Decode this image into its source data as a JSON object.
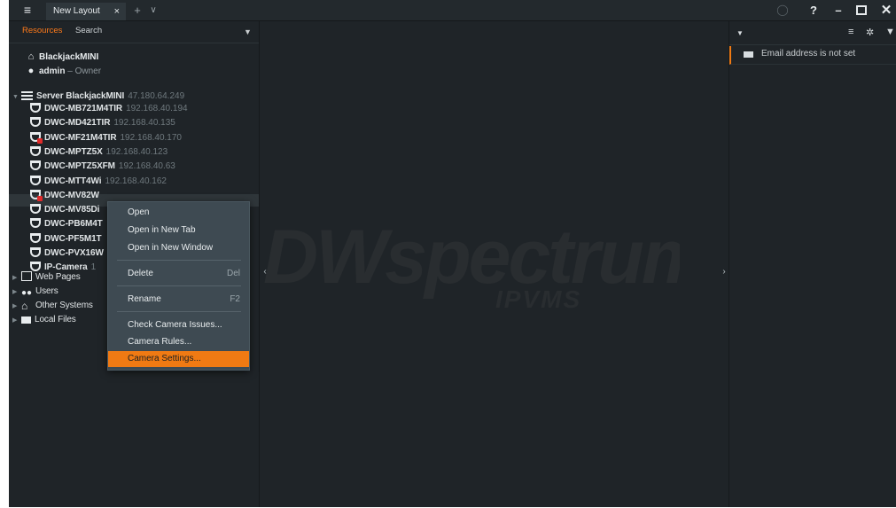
{
  "titlebar": {
    "tab_label": "New Layout",
    "tab_close": "×",
    "new_tab": "+",
    "tabs_menu": "∨",
    "help": "?",
    "minimize": "–",
    "close": "✕"
  },
  "left_panel": {
    "tabs": [
      "Resources",
      "Search"
    ],
    "system_name": "BlackjackMINI",
    "user": "admin",
    "user_role": "– Owner",
    "server": {
      "name": "Server BlackjackMINI",
      "ip": "47.180.64.249"
    },
    "cameras": [
      {
        "name": "DWC-MB721M4TIR",
        "ip": "192.168.40.194",
        "error": false
      },
      {
        "name": "DWC-MD421TIR",
        "ip": "192.168.40.135",
        "error": false
      },
      {
        "name": "DWC-MF21M4TIR",
        "ip": "192.168.40.170",
        "error": true
      },
      {
        "name": "DWC-MPTZ5X",
        "ip": "192.168.40.123",
        "error": false
      },
      {
        "name": "DWC-MPTZ5XFM",
        "ip": "192.168.40.63",
        "error": false
      },
      {
        "name": "DWC-MTT4Wi",
        "ip": "192.168.40.162",
        "error": false
      },
      {
        "name": "DWC-MV82W",
        "ip": "",
        "error": true
      },
      {
        "name": "DWC-MV85Di",
        "ip": "",
        "error": false
      },
      {
        "name": "DWC-PB6M4T",
        "ip": "",
        "error": false
      },
      {
        "name": "DWC-PF5M1T",
        "ip": "",
        "error": false
      },
      {
        "name": "DWC-PVX16W",
        "ip": "",
        "error": false
      },
      {
        "name": "IP-Camera",
        "ip": "1",
        "error": false
      }
    ],
    "groups": [
      "Web Pages",
      "Users",
      "Other Systems",
      "Local Files"
    ]
  },
  "context_menu": {
    "items": [
      {
        "label": "Open",
        "shortcut": ""
      },
      {
        "label": "Open in New Tab",
        "shortcut": ""
      },
      {
        "label": "Open in New Window",
        "shortcut": ""
      },
      {
        "label": "Delete",
        "shortcut": "Del"
      },
      {
        "label": "Rename",
        "shortcut": "F2"
      },
      {
        "label": "Check Camera Issues...",
        "shortcut": ""
      },
      {
        "label": "Camera Rules...",
        "shortcut": ""
      },
      {
        "label": "Camera Settings...",
        "shortcut": ""
      }
    ],
    "highlighted_index": 7
  },
  "center": {
    "logo_main": "DWspectrum",
    "logo_sub": "IPVMS",
    "left_handle": "‹",
    "right_handle": "›"
  },
  "right_panel": {
    "notification": "Email address is not set"
  },
  "colors": {
    "accent": "#f07a13",
    "error": "#e02a2a"
  }
}
